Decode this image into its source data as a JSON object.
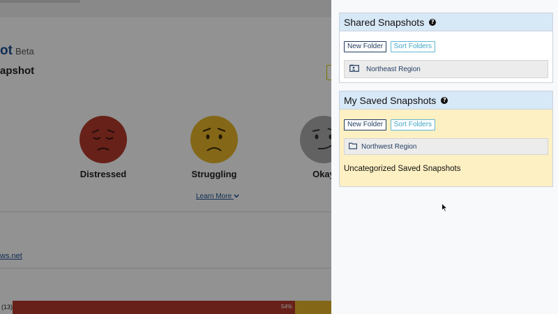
{
  "background": {
    "title": "ot",
    "title_badge": "Beta",
    "subtitle": "apshot",
    "moods": [
      {
        "label": "Distressed",
        "color": "#b23a2b"
      },
      {
        "label": "Struggling",
        "color": "#e3b42a"
      },
      {
        "label": "Okay",
        "color": "#a9a9a9"
      }
    ],
    "learn_more": "Learn More",
    "link_fragment": "ws.net",
    "bar": {
      "count": "(13)",
      "percent_label": "54%",
      "percent": 54
    }
  },
  "panel": {
    "shared": {
      "title": "Shared Snapshots",
      "new_folder": "New Folder",
      "sort_folders": "Sort Folders",
      "folders": [
        {
          "label": "Northeast Region",
          "icon": "shared-folder-icon"
        }
      ]
    },
    "mine": {
      "title": "My Saved Snapshots",
      "new_folder": "New Folder",
      "sort_folders": "Sort Folders",
      "folders": [
        {
          "label": "Northwest Region",
          "icon": "folder-icon"
        }
      ],
      "uncategorized": "Uncategorized Saved Snapshots"
    }
  },
  "colors": {
    "header_bg": "#d7e8f7",
    "mine_bg": "#fdf0c3",
    "link": "#1d4f8f",
    "overlay": "rgba(0,0,0,0.42)"
  }
}
